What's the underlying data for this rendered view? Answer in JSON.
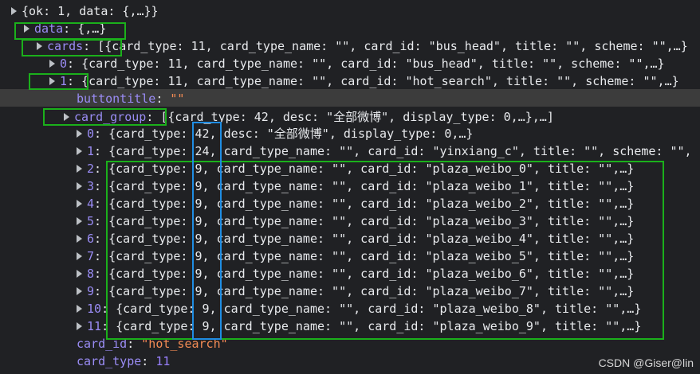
{
  "tree": {
    "root": "{ok: 1, data: {,…}}",
    "data_key": "data",
    "data_val": "{,…}",
    "cards_key": "cards",
    "cards_val": "[{card_type: 11, card_type_name: \"\", card_id: \"bus_head\", title: \"\", scheme: \"\",…}",
    "card0_key": "0",
    "card0_val": "{card_type: 11, card_type_name: \"\", card_id: \"bus_head\", title: \"\", scheme: \"\",…}",
    "card1_key": "1",
    "card1_val": "{card_type: 11, card_type_name: \"\", card_id: \"hot_search\", title: \"\", scheme: \"\",…}",
    "buttontitle_key": "buttontitle",
    "buttontitle_val": "\"\"",
    "card_group_key": "card_group",
    "card_group_val": "[{card_type: 42, desc: \"全部微博\", display_type: 0,…},…]",
    "group_items": [
      {
        "key": "0",
        "val": "{card_type: 42, desc: \"全部微博\", display_type: 0,…}"
      },
      {
        "key": "1",
        "val": "{card_type: 24, card_type_name: \"\", card_id: \"yinxiang_c\", title: \"\", scheme: \"\","
      },
      {
        "key": "2",
        "val": "{card_type: 9, card_type_name: \"\", card_id: \"plaza_weibo_0\", title: \"\",…}"
      },
      {
        "key": "3",
        "val": "{card_type: 9, card_type_name: \"\", card_id: \"plaza_weibo_1\", title: \"\",…}"
      },
      {
        "key": "4",
        "val": "{card_type: 9, card_type_name: \"\", card_id: \"plaza_weibo_2\", title: \"\",…}"
      },
      {
        "key": "5",
        "val": "{card_type: 9, card_type_name: \"\", card_id: \"plaza_weibo_3\", title: \"\",…}"
      },
      {
        "key": "6",
        "val": "{card_type: 9, card_type_name: \"\", card_id: \"plaza_weibo_4\", title: \"\",…}"
      },
      {
        "key": "7",
        "val": "{card_type: 9, card_type_name: \"\", card_id: \"plaza_weibo_5\", title: \"\",…}"
      },
      {
        "key": "8",
        "val": "{card_type: 9, card_type_name: \"\", card_id: \"plaza_weibo_6\", title: \"\",…}"
      },
      {
        "key": "9",
        "val": "{card_type: 9, card_type_name: \"\", card_id: \"plaza_weibo_7\", title: \"\",…}"
      },
      {
        "key": "10",
        "val": "{card_type: 9, card_type_name: \"\", card_id: \"plaza_weibo_8\", title: \"\",…}"
      },
      {
        "key": "11",
        "val": "{card_type: 9, card_type_name: \"\", card_id: \"plaza_weibo_9\", title: \"\",…}"
      }
    ],
    "card_id_key": "card_id",
    "card_id_val": "\"hot_search\"",
    "card_type_key": "card_type",
    "card_type_val": "11"
  },
  "watermark": "CSDN @Giser@lin",
  "colors": {
    "green_box": "#1bb01b",
    "blue_box": "#1f8de3",
    "background": "#202124"
  }
}
